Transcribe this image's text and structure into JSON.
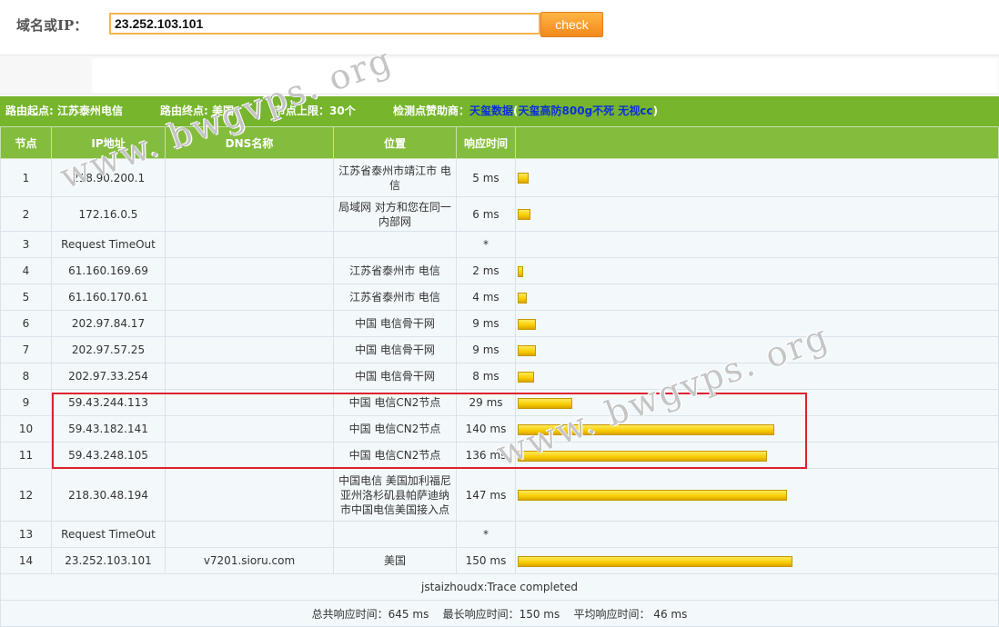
{
  "search": {
    "label": "域名或IP：",
    "value": "23.252.103.101",
    "button": "check"
  },
  "route_info": {
    "start": "路由起点: 江苏泰州电信",
    "end": "路由终点: 美国",
    "limit": "节点上限：30个",
    "sponsor_label": "检测点赞助商：",
    "sponsor_name": "天玺数据",
    "sponsor_paren_open": "(",
    "sponsor_note": "天玺高防800g不死 无视cc",
    "sponsor_paren_close": ")"
  },
  "table": {
    "headers": [
      "节点",
      "IP地址",
      "DNS名称",
      "位置",
      "响应时间",
      ""
    ],
    "rows": [
      {
        "hop": "1",
        "ip": "218.90.200.1",
        "dns": "",
        "loc": "江苏省泰州市靖江市 电信",
        "time": "5 ms",
        "ms": 5
      },
      {
        "hop": "2",
        "ip": "172.16.0.5",
        "dns": "",
        "loc": "局域网 对方和您在同一内部网",
        "time": "6 ms",
        "ms": 6
      },
      {
        "hop": "3",
        "ip": "Request TimeOut",
        "dns": "",
        "loc": "",
        "time": "*",
        "ms": 0
      },
      {
        "hop": "4",
        "ip": "61.160.169.69",
        "dns": "",
        "loc": "江苏省泰州市 电信",
        "time": "2 ms",
        "ms": 2
      },
      {
        "hop": "5",
        "ip": "61.160.170.61",
        "dns": "",
        "loc": "江苏省泰州市 电信",
        "time": "4 ms",
        "ms": 4
      },
      {
        "hop": "6",
        "ip": "202.97.84.17",
        "dns": "",
        "loc": "中国 电信骨干网",
        "time": "9 ms",
        "ms": 9
      },
      {
        "hop": "7",
        "ip": "202.97.57.25",
        "dns": "",
        "loc": "中国 电信骨干网",
        "time": "9 ms",
        "ms": 9
      },
      {
        "hop": "8",
        "ip": "202.97.33.254",
        "dns": "",
        "loc": "中国 电信骨干网",
        "time": "8 ms",
        "ms": 8
      },
      {
        "hop": "9",
        "ip": "59.43.244.113",
        "dns": "",
        "loc": "中国 电信CN2节点",
        "time": "29 ms",
        "ms": 29
      },
      {
        "hop": "10",
        "ip": "59.43.182.141",
        "dns": "",
        "loc": "中国 电信CN2节点",
        "time": "140 ms",
        "ms": 140
      },
      {
        "hop": "11",
        "ip": "59.43.248.105",
        "dns": "",
        "loc": "中国 电信CN2节点",
        "time": "136 ms",
        "ms": 136
      },
      {
        "hop": "12",
        "ip": "218.30.48.194",
        "dns": "",
        "loc": "中国电信 美国加利福尼亚州洛杉矶县帕萨迪纳市中国电信美国接入点",
        "time": "147 ms",
        "ms": 147
      },
      {
        "hop": "13",
        "ip": "Request TimeOut",
        "dns": "",
        "loc": "",
        "time": "*",
        "ms": 0
      },
      {
        "hop": "14",
        "ip": "23.252.103.101",
        "dns": "v7201.sioru.com",
        "loc": "美国",
        "time": "150 ms",
        "ms": 150
      }
    ],
    "completed": "jstaizhoudx:Trace completed",
    "summary": "总共响应时间：645 ms    最长响应时间：150 ms    平均响应时间： 46 ms"
  },
  "watermark": "www. bwgvps. org"
}
